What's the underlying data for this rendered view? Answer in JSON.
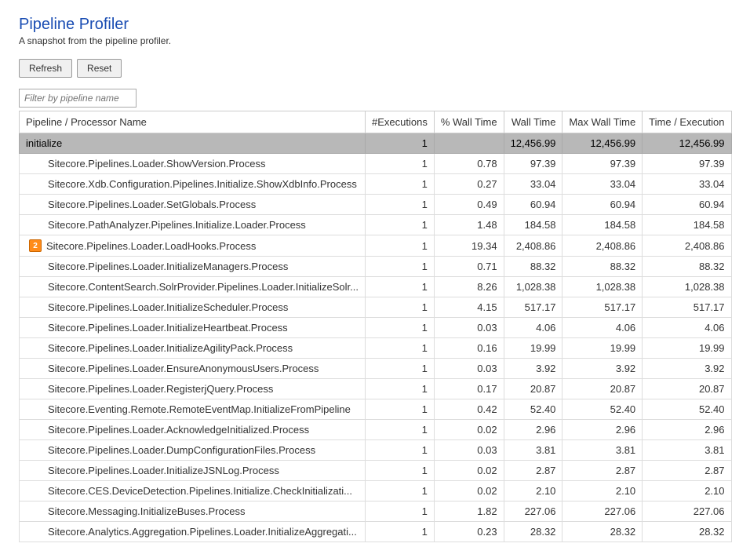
{
  "title": "Pipeline Profiler",
  "subtitle": "A snapshot from the pipeline profiler.",
  "toolbar": {
    "refresh": "Refresh",
    "reset": "Reset"
  },
  "filter": {
    "placeholder": "Filter by pipeline name"
  },
  "columns": {
    "name": "Pipeline / Processor Name",
    "executions": "#Executions",
    "pctWallTime": "% Wall Time",
    "wallTime": "Wall Time",
    "maxWallTime": "Max Wall Time",
    "timePerExecution": "Time / Execution"
  },
  "group": {
    "name": "initialize",
    "executions": "1",
    "pctWallTime": "",
    "wallTime": "12,456.99",
    "maxWallTime": "12,456.99",
    "timePerExecution": "12,456.99"
  },
  "rows": [
    {
      "badge": null,
      "name": "Sitecore.Pipelines.Loader.ShowVersion.Process",
      "executions": "1",
      "pctWallTime": "0.78",
      "wallTime": "97.39",
      "maxWallTime": "97.39",
      "timePerExecution": "97.39"
    },
    {
      "badge": null,
      "name": "Sitecore.Xdb.Configuration.Pipelines.Initialize.ShowXdbInfo.Process",
      "executions": "1",
      "pctWallTime": "0.27",
      "wallTime": "33.04",
      "maxWallTime": "33.04",
      "timePerExecution": "33.04"
    },
    {
      "badge": null,
      "name": "Sitecore.Pipelines.Loader.SetGlobals.Process",
      "executions": "1",
      "pctWallTime": "0.49",
      "wallTime": "60.94",
      "maxWallTime": "60.94",
      "timePerExecution": "60.94"
    },
    {
      "badge": null,
      "name": "Sitecore.PathAnalyzer.Pipelines.Initialize.Loader.Process",
      "executions": "1",
      "pctWallTime": "1.48",
      "wallTime": "184.58",
      "maxWallTime": "184.58",
      "timePerExecution": "184.58"
    },
    {
      "badge": "2",
      "name": "Sitecore.Pipelines.Loader.LoadHooks.Process",
      "executions": "1",
      "pctWallTime": "19.34",
      "wallTime": "2,408.86",
      "maxWallTime": "2,408.86",
      "timePerExecution": "2,408.86"
    },
    {
      "badge": null,
      "name": "Sitecore.Pipelines.Loader.InitializeManagers.Process",
      "executions": "1",
      "pctWallTime": "0.71",
      "wallTime": "88.32",
      "maxWallTime": "88.32",
      "timePerExecution": "88.32"
    },
    {
      "badge": null,
      "name": "Sitecore.ContentSearch.SolrProvider.Pipelines.Loader.InitializeSolr...",
      "executions": "1",
      "pctWallTime": "8.26",
      "wallTime": "1,028.38",
      "maxWallTime": "1,028.38",
      "timePerExecution": "1,028.38"
    },
    {
      "badge": null,
      "name": "Sitecore.Pipelines.Loader.InitializeScheduler.Process",
      "executions": "1",
      "pctWallTime": "4.15",
      "wallTime": "517.17",
      "maxWallTime": "517.17",
      "timePerExecution": "517.17"
    },
    {
      "badge": null,
      "name": "Sitecore.Pipelines.Loader.InitializeHeartbeat.Process",
      "executions": "1",
      "pctWallTime": "0.03",
      "wallTime": "4.06",
      "maxWallTime": "4.06",
      "timePerExecution": "4.06"
    },
    {
      "badge": null,
      "name": "Sitecore.Pipelines.Loader.InitializeAgilityPack.Process",
      "executions": "1",
      "pctWallTime": "0.16",
      "wallTime": "19.99",
      "maxWallTime": "19.99",
      "timePerExecution": "19.99"
    },
    {
      "badge": null,
      "name": "Sitecore.Pipelines.Loader.EnsureAnonymousUsers.Process",
      "executions": "1",
      "pctWallTime": "0.03",
      "wallTime": "3.92",
      "maxWallTime": "3.92",
      "timePerExecution": "3.92"
    },
    {
      "badge": null,
      "name": "Sitecore.Pipelines.Loader.RegisterjQuery.Process",
      "executions": "1",
      "pctWallTime": "0.17",
      "wallTime": "20.87",
      "maxWallTime": "20.87",
      "timePerExecution": "20.87"
    },
    {
      "badge": null,
      "name": "Sitecore.Eventing.Remote.RemoteEventMap.InitializeFromPipeline",
      "executions": "1",
      "pctWallTime": "0.42",
      "wallTime": "52.40",
      "maxWallTime": "52.40",
      "timePerExecution": "52.40"
    },
    {
      "badge": null,
      "name": "Sitecore.Pipelines.Loader.AcknowledgeInitialized.Process",
      "executions": "1",
      "pctWallTime": "0.02",
      "wallTime": "2.96",
      "maxWallTime": "2.96",
      "timePerExecution": "2.96"
    },
    {
      "badge": null,
      "name": "Sitecore.Pipelines.Loader.DumpConfigurationFiles.Process",
      "executions": "1",
      "pctWallTime": "0.03",
      "wallTime": "3.81",
      "maxWallTime": "3.81",
      "timePerExecution": "3.81"
    },
    {
      "badge": null,
      "name": "Sitecore.Pipelines.Loader.InitializeJSNLog.Process",
      "executions": "1",
      "pctWallTime": "0.02",
      "wallTime": "2.87",
      "maxWallTime": "2.87",
      "timePerExecution": "2.87"
    },
    {
      "badge": null,
      "name": "Sitecore.CES.DeviceDetection.Pipelines.Initialize.CheckInitializati...",
      "executions": "1",
      "pctWallTime": "0.02",
      "wallTime": "2.10",
      "maxWallTime": "2.10",
      "timePerExecution": "2.10"
    },
    {
      "badge": null,
      "name": "Sitecore.Messaging.InitializeBuses.Process",
      "executions": "1",
      "pctWallTime": "1.82",
      "wallTime": "227.06",
      "maxWallTime": "227.06",
      "timePerExecution": "227.06"
    },
    {
      "badge": null,
      "name": "Sitecore.Analytics.Aggregation.Pipelines.Loader.InitializeAggregati...",
      "executions": "1",
      "pctWallTime": "0.23",
      "wallTime": "28.32",
      "maxWallTime": "28.32",
      "timePerExecution": "28.32"
    }
  ]
}
